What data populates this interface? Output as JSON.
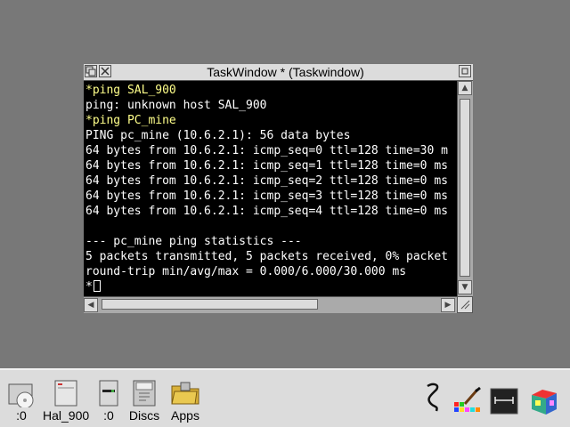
{
  "window": {
    "title": "TaskWindow * (Taskwindow)",
    "lines": [
      {
        "text": "*ping SAL_900",
        "type": "cmd"
      },
      {
        "text": "ping: unknown host SAL_900",
        "type": "out"
      },
      {
        "text": "*ping PC_mine",
        "type": "cmd"
      },
      {
        "text": "PING pc_mine (10.6.2.1): 56 data bytes",
        "type": "out"
      },
      {
        "text": "64 bytes from 10.6.2.1: icmp_seq=0 ttl=128 time=30 m",
        "type": "out"
      },
      {
        "text": "64 bytes from 10.6.2.1: icmp_seq=1 ttl=128 time=0 ms",
        "type": "out"
      },
      {
        "text": "64 bytes from 10.6.2.1: icmp_seq=2 ttl=128 time=0 ms",
        "type": "out"
      },
      {
        "text": "64 bytes from 10.6.2.1: icmp_seq=3 ttl=128 time=0 ms",
        "type": "out"
      },
      {
        "text": "64 bytes from 10.6.2.1: icmp_seq=4 ttl=128 time=0 ms",
        "type": "out"
      },
      {
        "text": "",
        "type": "out"
      },
      {
        "text": "--- pc_mine ping statistics ---",
        "type": "out"
      },
      {
        "text": "5 packets transmitted, 5 packets received, 0% packet",
        "type": "out"
      },
      {
        "text": "round-trip min/avg/max = 0.000/6.000/30.000 ms",
        "type": "out"
      }
    ],
    "prompt": "*"
  },
  "iconbar": {
    "left": [
      {
        "label": ":0",
        "icon": "cd-drive-icon"
      },
      {
        "label": "Hal_900",
        "icon": "network-drive-icon"
      },
      {
        "label": ":0",
        "icon": "floppy-drive-icon"
      },
      {
        "label": "Discs",
        "icon": "discs-icon"
      },
      {
        "label": "Apps",
        "icon": "apps-folder-icon"
      }
    ],
    "right": [
      {
        "icon": "task-manager-icon"
      },
      {
        "icon": "paint-app-icon"
      },
      {
        "icon": "draw-app-icon"
      },
      {
        "icon": "display-manager-icon"
      }
    ]
  },
  "colors": {
    "desktop": "#787878",
    "terminal_bg": "#000000",
    "terminal_text": "#ffffff",
    "command_text": "#ffff8a",
    "window_chrome": "#dcdcdc"
  }
}
